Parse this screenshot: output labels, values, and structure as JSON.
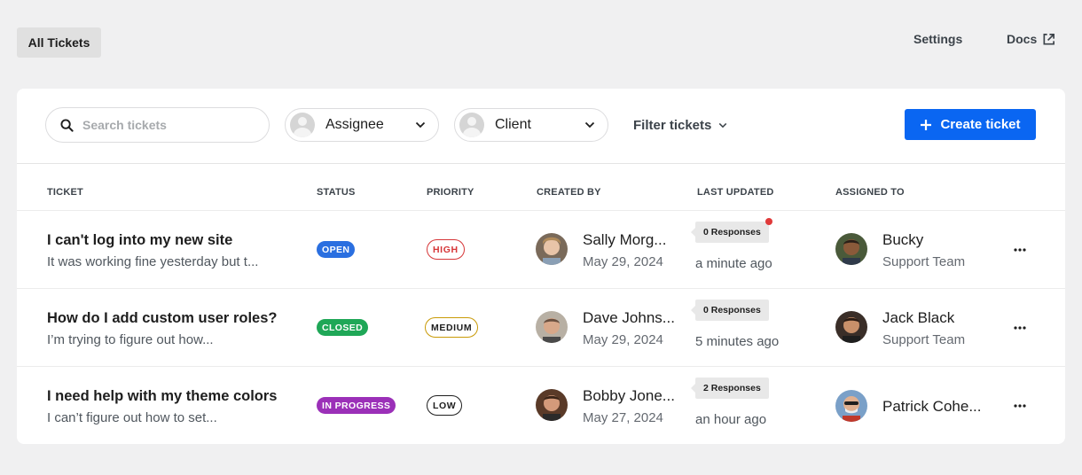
{
  "nav": {
    "tab_label": "All Tickets",
    "settings_label": "Settings",
    "docs_label": "Docs"
  },
  "toolbar": {
    "search_placeholder": "Search tickets",
    "assignee_label": "Assignee",
    "client_label": "Client",
    "filter_label": "Filter tickets",
    "create_label": "Create ticket"
  },
  "table": {
    "headers": {
      "ticket": "TICKET",
      "status": "STATUS",
      "priority": "PRIORITY",
      "created_by": "CREATED BY",
      "last_updated": "LAST UPDATED",
      "assigned_to": "ASSIGNED TO"
    },
    "rows": [
      {
        "title": "I can't log into my new site",
        "excerpt": "It was working fine yesterday but t...",
        "status": "OPEN",
        "status_color": "#2a6fe0",
        "priority": "HIGH",
        "priority_color": "#d63638",
        "creator_name": "Sally Morg...",
        "created_date": "May 29, 2024",
        "responses": "0 Responses",
        "has_unread": true,
        "updated": "a minute ago",
        "assignee_name": "Bucky",
        "assignee_team": "Support Team"
      },
      {
        "title": "How do I add custom user roles?",
        "excerpt": "I’m trying to figure out how...",
        "status": "CLOSED",
        "status_color": "#1fa757",
        "priority": "MEDIUM",
        "priority_color": "#c99a06",
        "creator_name": "Dave Johns...",
        "created_date": "May 29, 2024",
        "responses": "0 Responses",
        "has_unread": false,
        "updated": "5 minutes ago",
        "assignee_name": "Jack Black",
        "assignee_team": "Support Team"
      },
      {
        "title": "I need help with my theme colors",
        "excerpt": "I can’t figure out how to set...",
        "status": "IN PROGRESS",
        "status_color": "#9b30b8",
        "priority": "LOW",
        "priority_color": "#1e1e1e",
        "creator_name": "Bobby Jone...",
        "created_date": "May 27, 2024",
        "responses": "2 Responses",
        "has_unread": false,
        "updated": "an hour ago",
        "assignee_name": "Patrick Cohe...",
        "assignee_team": ""
      }
    ]
  },
  "colors": {
    "accent": "#0a66f2",
    "background": "#f0f0f1",
    "unread_dot": "#e03a3a"
  },
  "icons": {
    "search": "search-icon",
    "chevron": "chevron-down-icon",
    "external": "external-link-icon",
    "plus": "plus-icon",
    "more": "more-horizontal-icon"
  }
}
